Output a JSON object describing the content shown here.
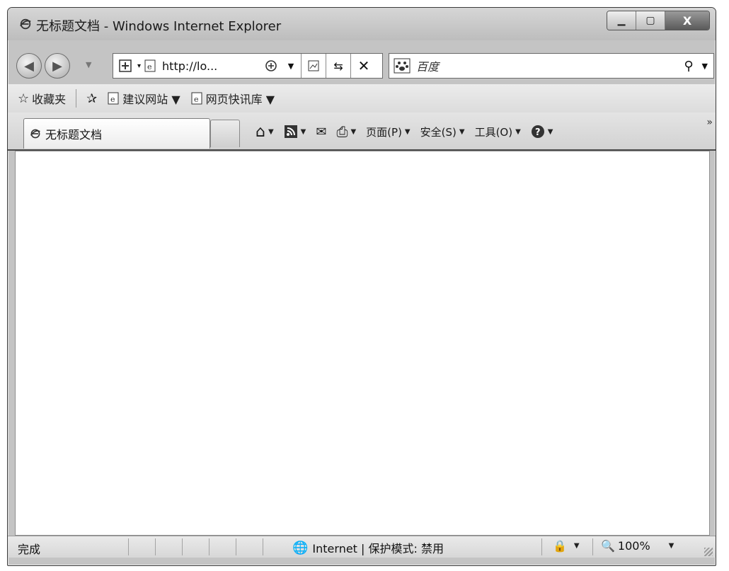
{
  "window": {
    "title": "无标题文档 - Windows Internet Explorer",
    "minimize_icon": "minimize-icon",
    "maximize_icon": "maximize-icon",
    "close_label": "X"
  },
  "address_bar": {
    "url": "http://lo...",
    "search_placeholder": "百度"
  },
  "favorites": {
    "favorites_label": "收藏夹",
    "items": [
      {
        "label": "建议网站 ▼"
      },
      {
        "label": "网页快讯库 ▼"
      }
    ]
  },
  "tab": {
    "title": "无标题文档"
  },
  "command_bar": {
    "page_label": "页面(P)",
    "safety_label": "安全(S)",
    "tools_label": "工具(O)",
    "more": "»"
  },
  "status_bar": {
    "status": "完成",
    "zone": "Internet | 保护模式: 禁用",
    "zoom": "100%"
  }
}
